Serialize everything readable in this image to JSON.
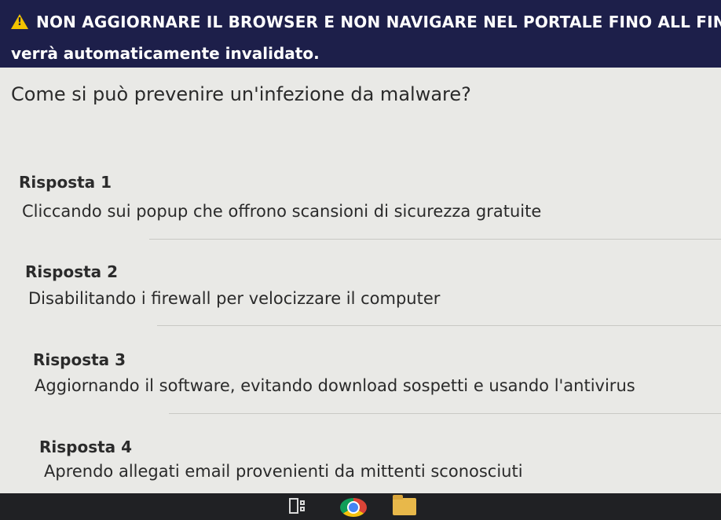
{
  "banner": {
    "line1": "NON AGGIORNARE IL BROWSER E NON NAVIGARE NEL PORTALE FINO ALL FINE DELL'ASSESS",
    "line2": "verrà automaticamente invalidato."
  },
  "question": "Come si può prevenire un'infezione da malware?",
  "answers": [
    {
      "label": "Risposta 1",
      "text": "Cliccando sui popup che offrono scansioni di sicurezza gratuite"
    },
    {
      "label": "Risposta 2",
      "text": "Disabilitando i firewall per velocizzare il computer"
    },
    {
      "label": "Risposta 3",
      "text": "Aggiornando il software, evitando download sospetti e usando l'antivirus"
    },
    {
      "label": "Risposta 4",
      "text": "Aprendo allegati email provenienti da mittenti sconosciuti"
    }
  ],
  "taskbar": {
    "icons": [
      "task-view-icon",
      "chrome-icon",
      "file-explorer-icon"
    ]
  },
  "colors": {
    "banner_bg": "#1d1f4a",
    "warning": "#f2c300",
    "page_bg": "#e9e9e6"
  }
}
